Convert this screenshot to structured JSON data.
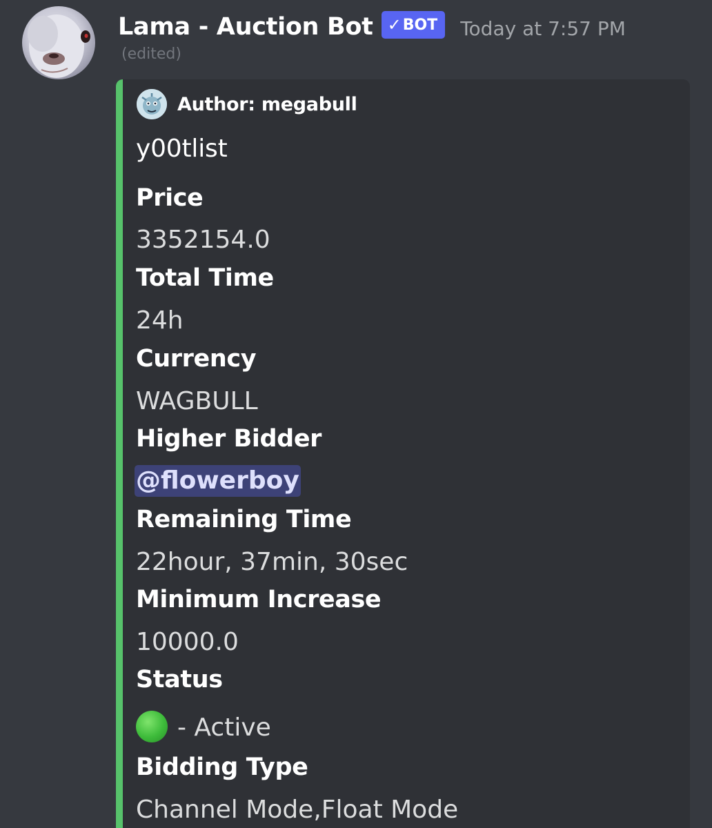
{
  "message": {
    "username": "Lama - Auction Bot",
    "bot_tag": "BOT",
    "bot_check": "✓",
    "timestamp": "Today at 7:57 PM",
    "edited": "(edited)",
    "avatar_icon": "llama-avatar-icon"
  },
  "embed": {
    "accent_color": "#57c26b",
    "author_icon": "author-avatar-icon",
    "author": "Author: megabull",
    "title": "y00tlist",
    "fields": [
      {
        "name": "Price",
        "value": "3352154.0"
      },
      {
        "name": "Total Time",
        "value": "24h"
      },
      {
        "name": "Currency",
        "value": "WAGBULL"
      },
      {
        "name": "Higher Bidder",
        "value": "@flowerboy"
      },
      {
        "name": "Remaining Time",
        "value": "22hour, 37min, 30sec"
      },
      {
        "name": "Minimum Increase",
        "value": "10000.0"
      },
      {
        "name": "Status",
        "value": "- Active",
        "icon": "green-circle-icon"
      },
      {
        "name": "Bidding Type",
        "value": "Channel Mode,Float Mode"
      }
    ]
  }
}
